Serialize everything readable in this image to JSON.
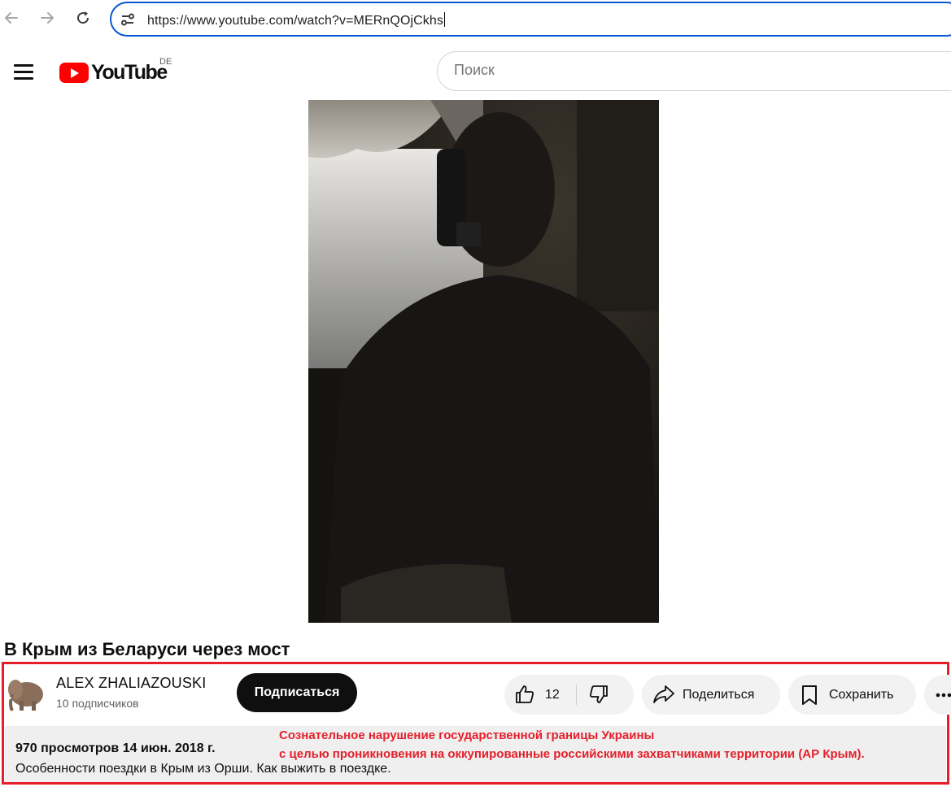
{
  "browser": {
    "url": "https://www.youtube.com/watch?v=MERnQOjCkhs"
  },
  "header": {
    "logo_text": "YouTube",
    "region": "DE",
    "search_placeholder": "Поиск"
  },
  "video": {
    "title": "В Крым из Беларуси через мост"
  },
  "channel": {
    "name": "ALEX ZHALIAZOUSKI",
    "subscribers": "10 подписчиков",
    "subscribe_label": "Подписаться"
  },
  "actions": {
    "like_count": "12",
    "share_label": "Поделиться",
    "save_label": "Сохранить"
  },
  "description": {
    "meta": "970 просмотров  14 июн. 2018 г.",
    "text": "Особенности поездки в Крым из Орши. Как выжить в поездке."
  },
  "annotation": {
    "line1": "Сознательное нарушение государственной границы Украины",
    "line2": "с целью проникновения на оккупированные российскими захватчиками территории (АР Крым)."
  },
  "colors": {
    "highlight": "#e51f2a",
    "youtube_red": "#ff0000",
    "omnibox_focus": "#0b57d0"
  }
}
